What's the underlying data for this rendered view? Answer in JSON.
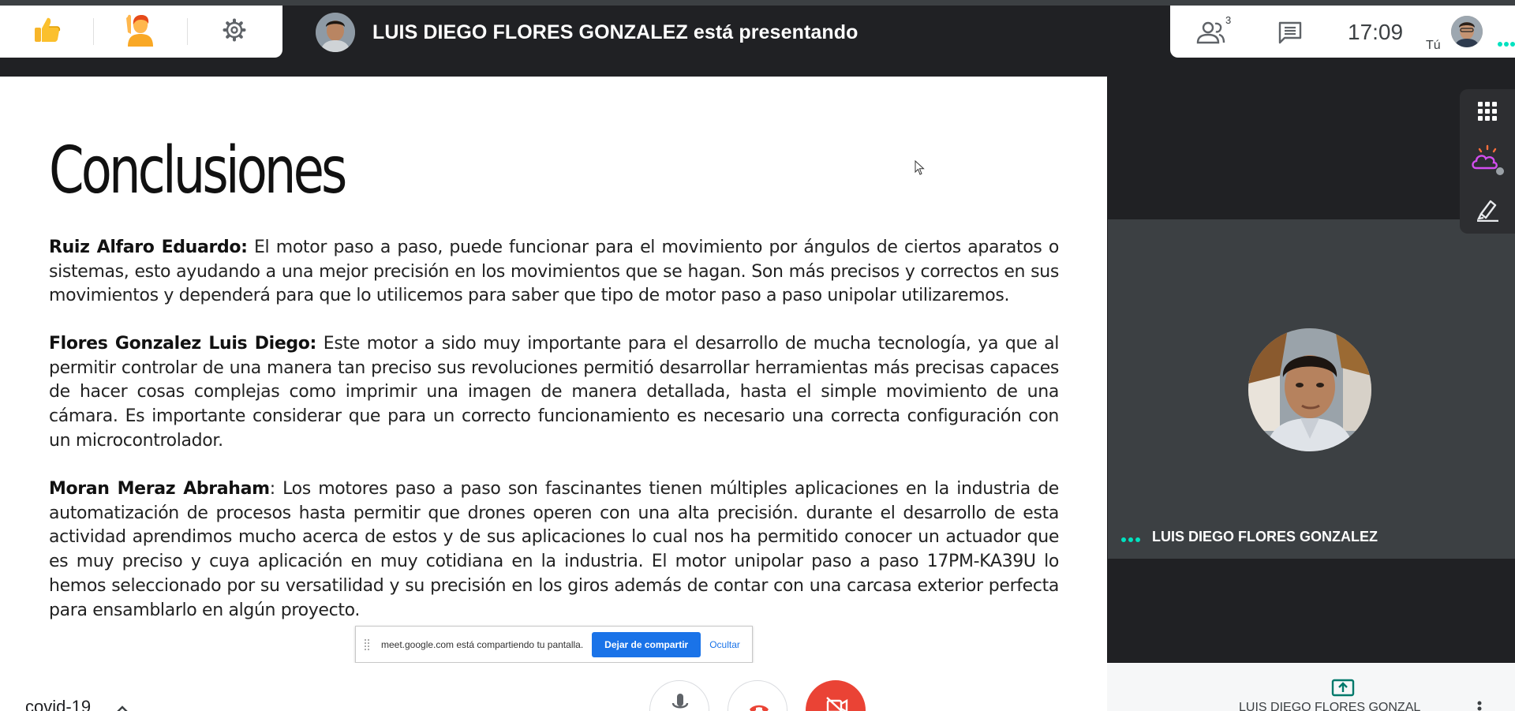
{
  "reactions": {
    "like_icon": "thumbs-up",
    "raise_hand_icon": "raise-hand",
    "settings_icon": "gear"
  },
  "presenter": {
    "banner_text": "LUIS DIEGO FLORES GONZALEZ está presentando"
  },
  "header_right": {
    "participants_count": "3",
    "clock": "17:09",
    "self_label": "Tú"
  },
  "slide": {
    "title": "Conclusiones",
    "paragraphs": [
      {
        "name": "Ruiz Alfaro Eduardo:",
        "text": " El motor paso a paso, puede funcionar para el movimiento por ángulos de ciertos aparatos o sistemas, esto ayudando a una mejor precisión en los movimientos que se hagan. Son más precisos y correctos en sus movimientos y dependerá para que lo utilicemos para saber que tipo de motor paso a paso unipolar utilizaremos."
      },
      {
        "name": "Flores Gonzalez Luis Diego:",
        "text": " Este motor a sido muy importante para el desarrollo de mucha tecnología, ya que al permitir controlar de una manera tan preciso sus revoluciones permitió desarrollar herramientas más precisas capaces de hacer cosas complejas como imprimir una imagen de manera detallada, hasta el simple movimiento de una cámara. Es importante considerar que para un correcto funcionamiento es necesario una correcta configuración con un microcontrolador."
      },
      {
        "name": "Moran Meraz Abraham",
        "text": ": Los motores paso a paso son fascinantes tienen múltiples aplicaciones en la industria de automatización de procesos hasta permitir que drones operen con una alta precisión. durante el desarrollo de esta actividad aprendimos mucho acerca de estos y de sus aplicaciones lo cual nos ha permitido conocer un actuador que es muy preciso y cuya aplicación en muy cotidiana en la industria. El motor unipolar paso a paso 17PM-KA39U lo hemos seleccionado por su versatilidad y su precisión en los giros además de contar con una carcasa exterior perfecta para ensamblarlo en algún proyecto."
      }
    ]
  },
  "share_notice": {
    "text": "meet.google.com está compartiendo tu pantalla.",
    "stop_label": "Dejar de compartir",
    "hide_label": "Ocultar"
  },
  "participant_tile": {
    "name": "LUIS DIEGO FLORES GONZALEZ"
  },
  "bottom": {
    "meeting_name": "covid-19",
    "presenting_name": "LUIS DIEGO FLORES GONZAL"
  },
  "colors": {
    "accent_blue": "#1a73e8",
    "hangup_red": "#ea4335",
    "speaking_green": "#00e2c0",
    "dark_bg": "#202124",
    "tile_bg": "#3c4043"
  }
}
